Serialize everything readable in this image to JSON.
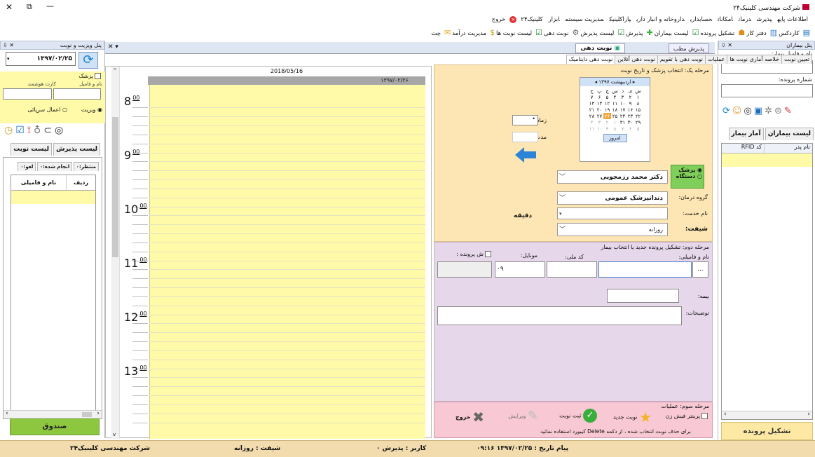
{
  "window": {
    "title": "شرکت مهندسی کلینیک۲۴",
    "min": "—",
    "restore": "⧉",
    "close": "✕"
  },
  "menu": [
    "اطلاعات پایه",
    "پذیرش",
    "درمان",
    "امکانات",
    "حسابداری",
    "داروخانه و انبار داری",
    "پاراکلینیک",
    "مدیریت سیستم",
    "ابزار",
    "کلینیک۲۴",
    "خروج"
  ],
  "toolbar": [
    "کاردکس",
    "دفتر کار",
    "تشکیل پرونده",
    "لیست بیماران",
    "پذیرش",
    "لیست پذیرش",
    "نوبت دهی",
    "لیست نوبت ها",
    "مدیریت درآمد",
    "چت"
  ],
  "right_panel": {
    "title": "پنل بیماران",
    "name_label": "نام و فامیل بیمار:",
    "file_label": "شماره پرونده:",
    "tabs": [
      "لیست بیماران",
      "آمار بیمار"
    ],
    "cols": [
      "نام پدر",
      "کد RFID"
    ],
    "create_btn": "تشکیل پرونده"
  },
  "doc_tabs": [
    "نوبت دهی",
    "پذیرش مطب"
  ],
  "sub_tabs": [
    "تعیین نوبت",
    "خلاصه آماری نوبت ها",
    "عملیات",
    "نوبت دهی با تقویم",
    "نوبت دهی آنلاین",
    "نوبت دهی داینامیک"
  ],
  "step1": {
    "title": "مرحله یک: انتخاب پزشک و تاریخ نوبت",
    "cal_month": "اردیبهشت",
    "cal_year": "۱۳۹۷",
    "cal_days": [
      "ش",
      "ی",
      "د",
      "س",
      "چ",
      "پ",
      "ج"
    ],
    "cal_rows": [
      [
        "۱",
        "۲",
        "۳",
        "۴",
        "۵",
        "۶",
        "۷"
      ],
      [
        "۸",
        "۹",
        "۱۰",
        "۱۱",
        "۱۲",
        "۱۳",
        "۱۴"
      ],
      [
        "۱۵",
        "۱۶",
        "۱۷",
        "۱۸",
        "۱۹",
        "۲۰",
        "۲۱"
      ],
      [
        "۲۲",
        "۲۳",
        "۲۴",
        "۲۵",
        "۲۶",
        "۲۷",
        "۲۸"
      ],
      [
        "۲۹",
        "۳۰",
        "۳۱",
        "۱",
        "۲",
        "۳",
        "۴"
      ],
      [
        "۵",
        "۶",
        "۷",
        "۸",
        "۹",
        "۱۰",
        "۱۱"
      ]
    ],
    "today_btn": "امروز",
    "visit_time": "زمان ویزیت :",
    "service_duration": "مدت خدمت :",
    "doctor_radio": "پزشک",
    "device_radio": "دستگاه",
    "doctor_value": "دکتر محمد رزمجویی",
    "group_label": "گروه درمان:",
    "group_value": "دندانپزشک عمومی",
    "service_label": "نام خدمت:",
    "minute": "دقیقه",
    "shift_label": "شیفت:",
    "shift_value": "روزانه"
  },
  "step2": {
    "title": "مرحله دوم: تشکیل پرونده جدید یا انتخاب بیمار",
    "name": "نام و فامیلی:",
    "national": "کد ملی:",
    "mobile": "موبایل:",
    "mobile_value": "۰۹",
    "file_no": "ش پرونده :",
    "insurance": "بیمه:",
    "notes": "توضیحات:",
    "browse": "..."
  },
  "step3": {
    "title": "مرحله سوم: عملیات",
    "print": "پرینتر فیش زن",
    "new": "نوبت جدید",
    "save": "ثبت نوبت",
    "edit": "ویرایش",
    "exit": "خروج",
    "hint": "برای حذف نوبت انتخاب شده ، از دکمه Delete کیبورد استفاده نمائید"
  },
  "schedule": {
    "date_en": "2018/05/16",
    "date_fa": "۱۳۹۷/۰۲/۲۶",
    "hours": [
      "8",
      "9",
      "10",
      "11",
      "12",
      "13"
    ],
    "minutes": "00"
  },
  "left_panel": {
    "title": "پنل ویزیت و نوبت",
    "date": "۱۳۹۷/۰۲/۲۵",
    "doctor_chk": "پزشک",
    "name_label": "نام و فامیل",
    "card_label": "کارت هوشمند",
    "visit": "ویزیت",
    "service": "اعمال سرپائی",
    "tabs": [
      "لیست پذیرش",
      "لیست نوبت"
    ],
    "subtabs": [
      "منتظر:۰",
      "انجام شده:۰",
      "لغو:۰"
    ],
    "cols": [
      "ردیف",
      "نام و فامیلی"
    ],
    "cash_btn": "صندوق"
  },
  "status": {
    "company": "شرکت مهندسی کلینیک۲۴",
    "shift": "شیفت : روزانه",
    "user": "کاربر : پذیرش ۰",
    "message": "پیام  تاریخ : ۱۳۹۷/۰۲/۲۵   ۰۹:۱۶",
    "company_right": "شرکت مهندسی کلینیک۲۴"
  },
  "colors": {
    "yellow": "#fffaa8",
    "peach": "#fde6b3",
    "purple": "#e6d7ea",
    "pink": "#f8c9d5",
    "green": "#8dc63f",
    "status": "#f2dcae"
  }
}
